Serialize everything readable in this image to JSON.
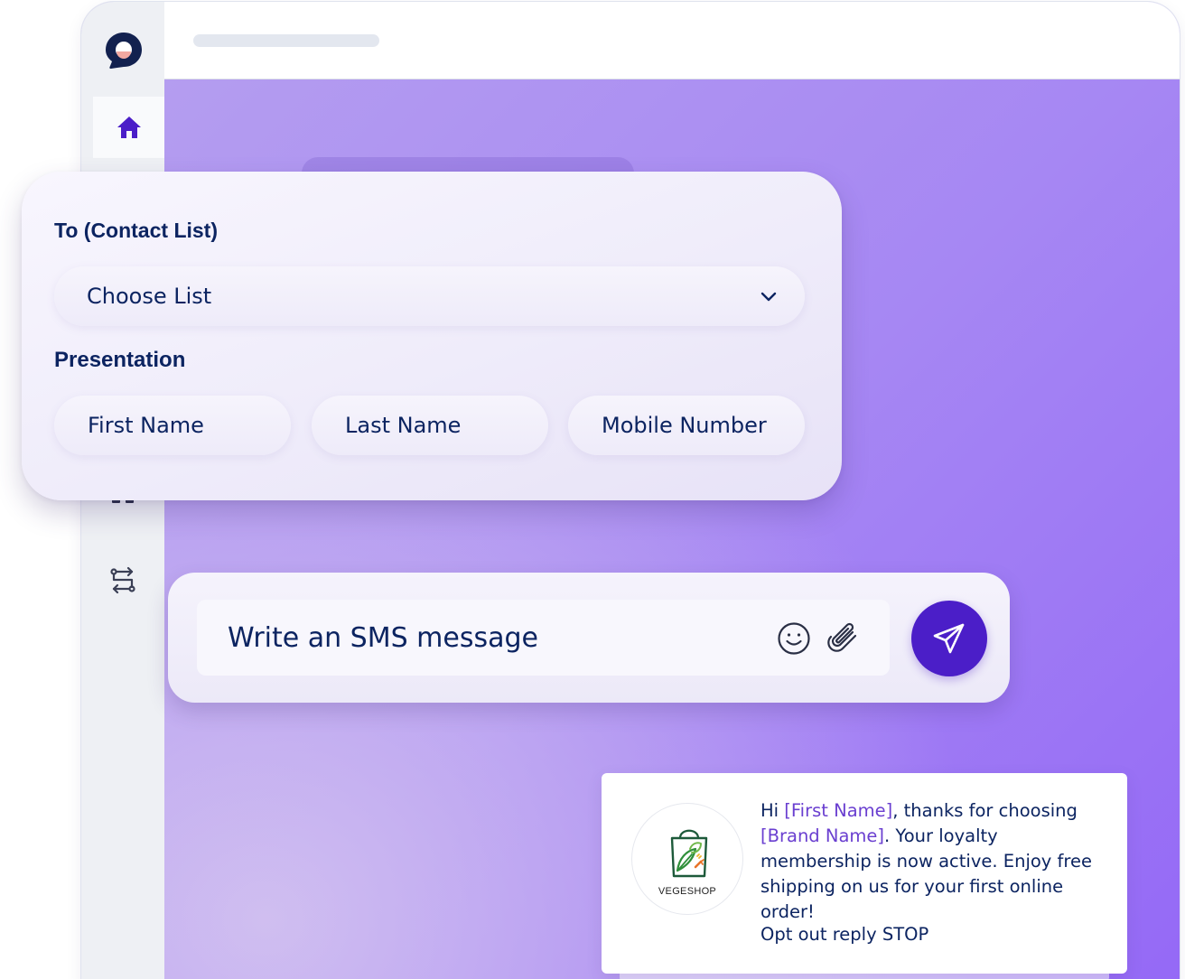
{
  "contact_panel": {
    "to_label": "To (Contact List)",
    "select_value": "Choose List",
    "presentation_label": "Presentation",
    "fields": [
      "First Name",
      "Last Name",
      "Mobile Number"
    ]
  },
  "composer": {
    "placeholder": "Write an SMS message"
  },
  "sms_preview": {
    "brand_name": "VEGESHOP",
    "greeting": "Hi ",
    "token_first_name": "[First Name]",
    "part_after_first_name": ", thanks for choosing ",
    "token_brand_name": "[Brand Name]",
    "part_after_brand_name": ". Your loyalty membership is now active. Enjoy free shipping on us for your first online order!",
    "opt_out": "Opt out reply STOP"
  },
  "colors": {
    "primary": "#4b1ec8",
    "text_navy": "#0c2461",
    "token_purple": "#6a3fd0",
    "gradient_start": "#b49df0",
    "gradient_end": "#9468f6"
  },
  "icons": {
    "logo": "chat-bubble-logo-icon",
    "home": "home-icon",
    "flows": "route-arrows-icon",
    "chevron": "chevron-down-icon",
    "emoji": "smiley-icon",
    "attach": "paperclip-icon",
    "send": "paper-plane-icon",
    "brand": "shopping-bag-leaf-icon"
  }
}
